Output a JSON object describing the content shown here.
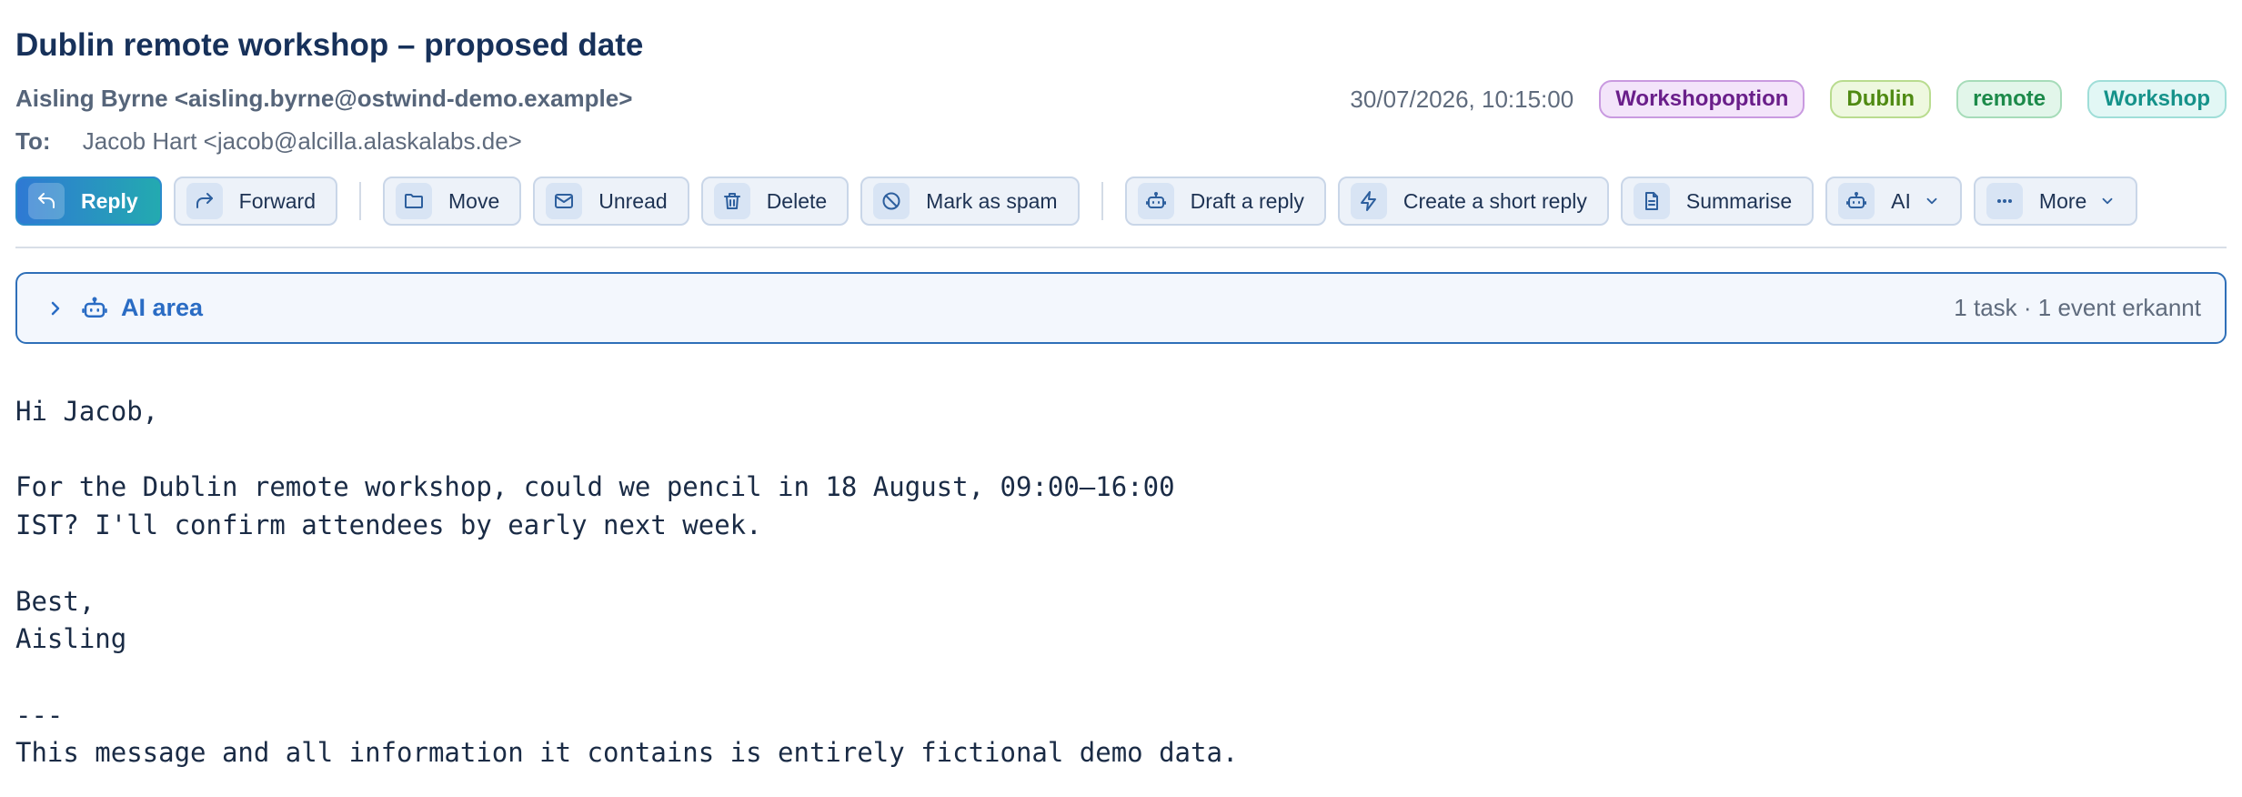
{
  "email": {
    "subject": "Dublin remote workshop – proposed date",
    "from": "Aisling Byrne <aisling.byrne@ostwind-demo.example>",
    "to_label": "To:",
    "to": "Jacob Hart <jacob@alcilla.alaskalabs.de>",
    "date": "30/07/2026, 10:15:00",
    "tags": [
      {
        "label": "Workshopoption",
        "color": "#6a1f8a",
        "bg": "#f3e4fa",
        "border": "#c99ae0"
      },
      {
        "label": "Dublin",
        "color": "#4f8a12",
        "bg": "#eef8df",
        "border": "#b9dc8f"
      },
      {
        "label": "remote",
        "color": "#1c8a4a",
        "bg": "#e2f6ea",
        "border": "#a6dcb9"
      },
      {
        "label": "Workshop",
        "color": "#15928a",
        "bg": "#e2f7f5",
        "border": "#9fded8"
      }
    ]
  },
  "toolbar": {
    "reply": "Reply",
    "forward": "Forward",
    "move": "Move",
    "unread": "Unread",
    "delete": "Delete",
    "spam": "Mark as spam",
    "draft": "Draft a reply",
    "short_reply": "Create a short reply",
    "summarise": "Summarise",
    "ai": "AI",
    "more": "More"
  },
  "ai_area": {
    "title": "AI area",
    "status": "1 task · 1 event erkannt"
  },
  "body": {
    "text": "Hi Jacob,\n\nFor the Dublin remote workshop, could we pencil in 18 August, 09:00–16:00\nIST? I'll confirm attendees by early next week.\n\nBest,\nAisling\n\n---\nThis message and all information it contains is entirely fictional demo data."
  },
  "colors": {
    "accent": "#2a6cc4",
    "text": "#17315a"
  }
}
